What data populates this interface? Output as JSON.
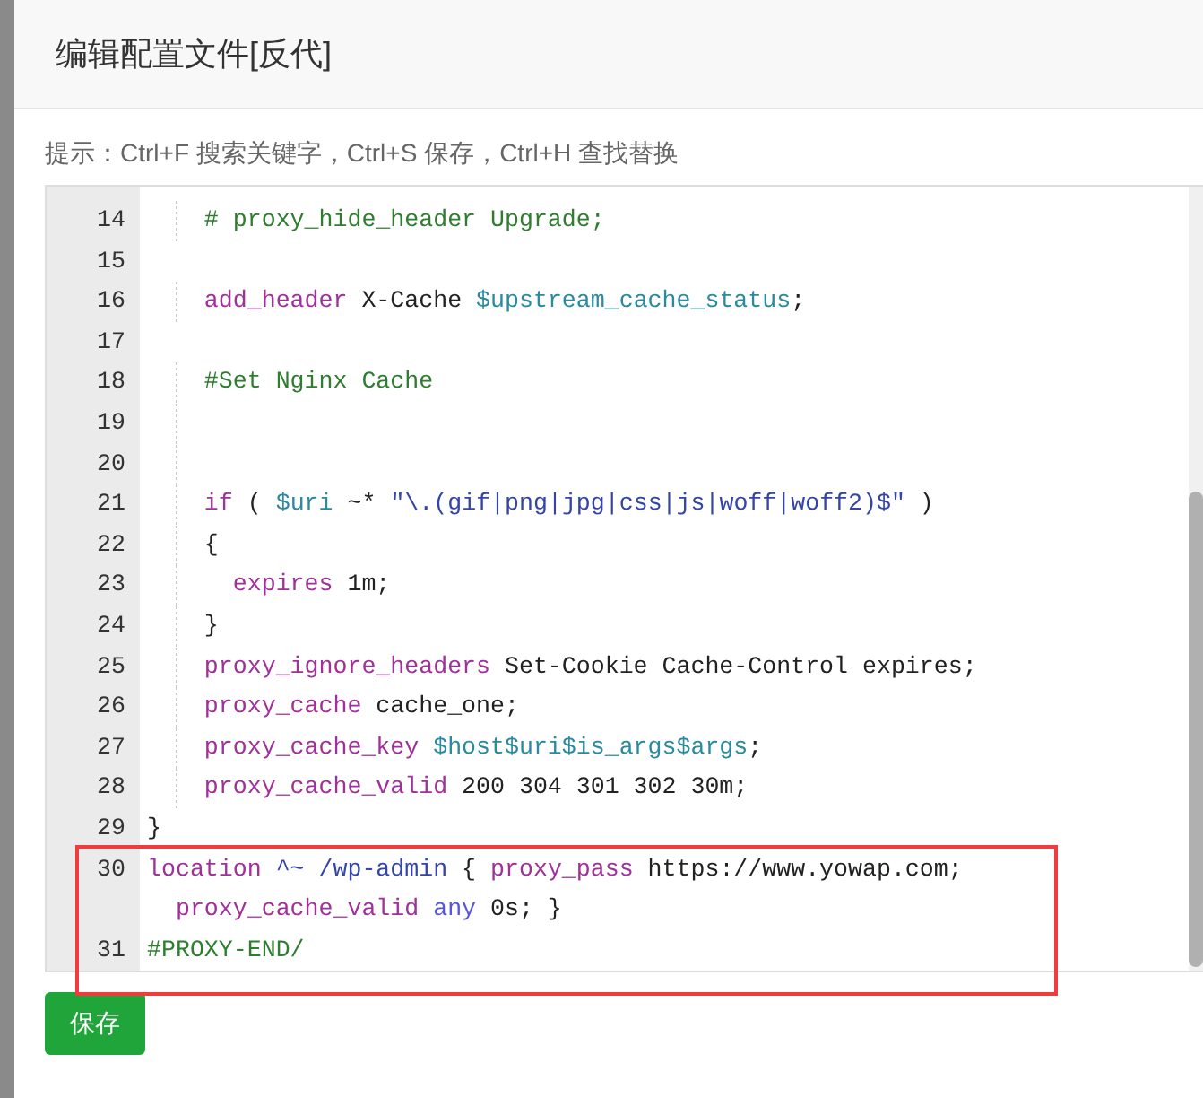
{
  "dialog": {
    "title": "编辑配置文件[反代]"
  },
  "hint": "提示：Ctrl+F 搜索关键字，Ctrl+S 保存，Ctrl+H 查找替换",
  "editor": {
    "lines": [
      {
        "number": "14",
        "guide": true,
        "tokens": [
          {
            "kind": "comment",
            "text": "    # proxy_hide_header Upgrade;"
          }
        ]
      },
      {
        "number": "15",
        "guide": false
      },
      {
        "number": "16",
        "guide": true,
        "tokens": [
          {
            "kind": "keyword",
            "text": "    add_header"
          },
          {
            "kind": "plain",
            "text": " X-Cache "
          },
          {
            "kind": "variable",
            "text": "$upstream_cache_status"
          },
          {
            "kind": "plain",
            "text": ";"
          }
        ]
      },
      {
        "number": "17",
        "guide": false
      },
      {
        "number": "18",
        "guide": true,
        "tokens": [
          {
            "kind": "comment",
            "text": "    #Set Nginx Cache"
          }
        ]
      },
      {
        "number": "19",
        "guide": true
      },
      {
        "number": "20",
        "guide": true
      },
      {
        "number": "21",
        "guide": true,
        "tokens": [
          {
            "kind": "keyword",
            "text": "    if"
          },
          {
            "kind": "plain",
            "text": " ( "
          },
          {
            "kind": "variable",
            "text": "$uri"
          },
          {
            "kind": "plain",
            "text": " ~* "
          },
          {
            "kind": "string",
            "text": "\"\\.(gif|png|jpg|css|js|woff|woff2)$\""
          },
          {
            "kind": "plain",
            "text": " )"
          }
        ]
      },
      {
        "number": "22",
        "guide": true,
        "tokens": [
          {
            "kind": "plain",
            "text": "    {"
          }
        ]
      },
      {
        "number": "23",
        "guide": true,
        "tokens": [
          {
            "kind": "keyword",
            "text": "      expires"
          },
          {
            "kind": "plain",
            "text": " 1m;"
          }
        ]
      },
      {
        "number": "24",
        "guide": true,
        "tokens": [
          {
            "kind": "plain",
            "text": "    }"
          }
        ]
      },
      {
        "number": "25",
        "guide": true,
        "tokens": [
          {
            "kind": "keyword",
            "text": "    proxy_ignore_headers"
          },
          {
            "kind": "plain",
            "text": " Set-Cookie Cache-Control expires;"
          }
        ]
      },
      {
        "number": "26",
        "guide": true,
        "tokens": [
          {
            "kind": "keyword",
            "text": "    proxy_cache"
          },
          {
            "kind": "plain",
            "text": " cache_one;"
          }
        ]
      },
      {
        "number": "27",
        "guide": true,
        "tokens": [
          {
            "kind": "keyword",
            "text": "    proxy_cache_key"
          },
          {
            "kind": "variable",
            "text": " $host$uri$is_args$args"
          },
          {
            "kind": "plain",
            "text": ";"
          }
        ]
      },
      {
        "number": "28",
        "guide": true,
        "tokens": [
          {
            "kind": "keyword",
            "text": "    proxy_cache_valid"
          },
          {
            "kind": "plain",
            "text": " 200 304 301 302 30m;"
          }
        ]
      },
      {
        "number": "29",
        "guide": false,
        "tokens": [
          {
            "kind": "plain",
            "text": "}"
          }
        ]
      },
      {
        "number": "30",
        "guide": false,
        "tokens": [
          {
            "kind": "keyword",
            "text": "location"
          },
          {
            "kind": "string",
            "text": " ^~ /wp-admin"
          },
          {
            "kind": "plain",
            "text": " { "
          },
          {
            "kind": "keyword",
            "text": "proxy_pass"
          },
          {
            "kind": "plain",
            "text": " https://www.yowap.com;"
          }
        ],
        "wrap_tokens": [
          {
            "kind": "keyword",
            "text": "  proxy_cache_valid"
          },
          {
            "kind": "atom",
            "text": " any"
          },
          {
            "kind": "plain",
            "text": " 0s; }"
          }
        ]
      },
      {
        "number": "31",
        "guide": false,
        "tokens": [
          {
            "kind": "comment",
            "text": "#PROXY-END/"
          }
        ]
      }
    ]
  },
  "save_button": "保存"
}
